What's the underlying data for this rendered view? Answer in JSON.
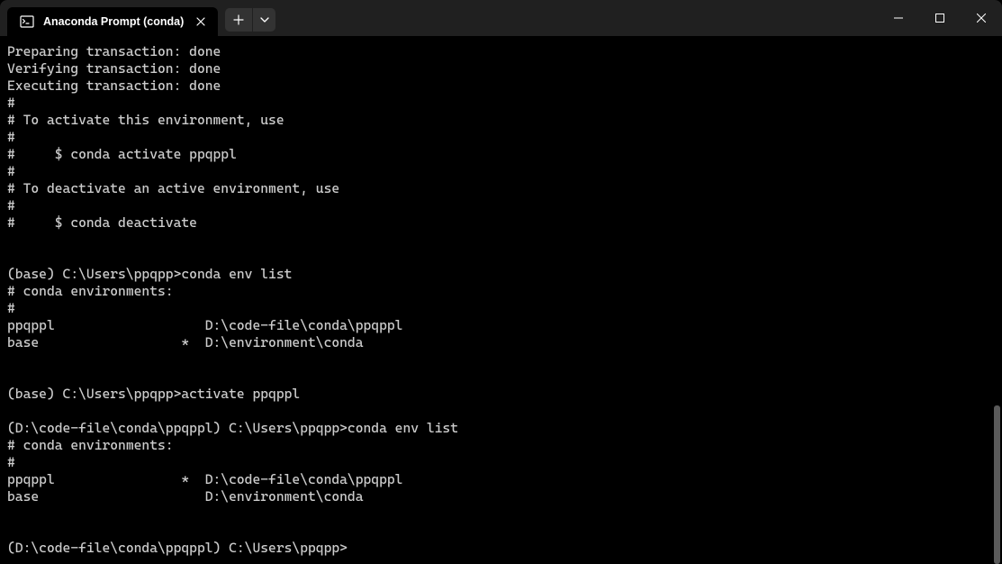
{
  "titlebar": {
    "tab_title": "Anaconda Prompt (conda)"
  },
  "terminal": {
    "lines": [
      "Preparing transaction: done",
      "Verifying transaction: done",
      "Executing transaction: done",
      "#",
      "# To activate this environment, use",
      "#",
      "#     $ conda activate ppqppl",
      "#",
      "# To deactivate an active environment, use",
      "#",
      "#     $ conda deactivate",
      "",
      "",
      "(base) C:\\Users\\ppqpp>conda env list",
      "# conda environments:",
      "#",
      "ppqppl                   D:\\code-file\\conda\\ppqppl",
      "base                  *  D:\\environment\\conda",
      "",
      "",
      "(base) C:\\Users\\ppqpp>activate ppqppl",
      "",
      "(D:\\code-file\\conda\\ppqppl) C:\\Users\\ppqpp>conda env list",
      "# conda environments:",
      "#",
      "ppqppl                *  D:\\code-file\\conda\\ppqppl",
      "base                     D:\\environment\\conda",
      "",
      "",
      "(D:\\code-file\\conda\\ppqppl) C:\\Users\\ppqpp>"
    ]
  }
}
